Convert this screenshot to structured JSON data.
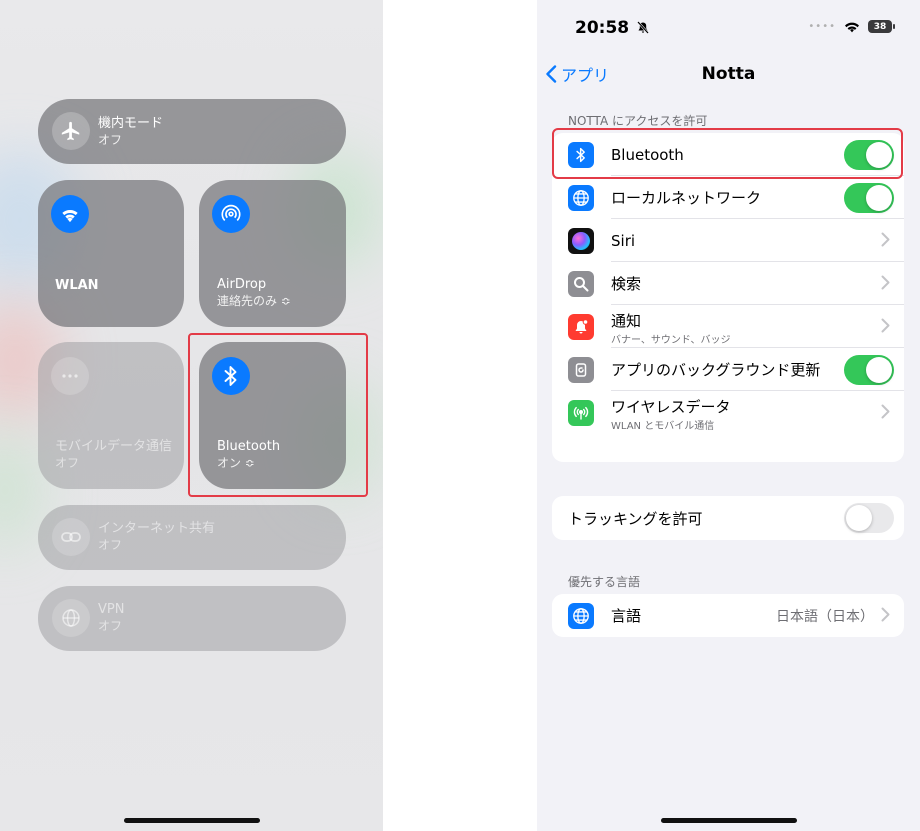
{
  "control_center": {
    "airplane": {
      "title": "機内モード",
      "status": "オフ",
      "icon": "airplane-icon"
    },
    "wlan": {
      "title": "WLAN",
      "icon": "wifi-icon"
    },
    "airdrop": {
      "title": "AirDrop",
      "status": "連絡先のみ ≎",
      "icon": "airdrop-icon"
    },
    "mobile_data": {
      "title": "モバイルデータ通信",
      "status": "オフ",
      "icon": "antenna-icon"
    },
    "bluetooth": {
      "title": "Bluetooth",
      "status": "オン ≎",
      "icon": "bluetooth-icon"
    },
    "hotspot": {
      "title": "インターネット共有",
      "status": "オフ",
      "icon": "link-icon"
    },
    "vpn": {
      "title": "VPN",
      "status": "オフ",
      "icon": "globe-icon"
    }
  },
  "settings": {
    "status_bar": {
      "time": "20:58",
      "battery": "38"
    },
    "nav": {
      "back_label": "アプリ",
      "title": "Notta"
    },
    "section_access": "NOTTA にアクセスを許可",
    "rows": [
      {
        "label": "Bluetooth",
        "icon": "bluetooth-icon",
        "icon_bg": "#0a7aff",
        "toggle": true
      },
      {
        "label": "ローカルネットワーク",
        "icon": "globe-network-icon",
        "icon_bg": "#0a7aff",
        "toggle": true
      },
      {
        "label": "Siri",
        "icon": "siri-icon",
        "icon_bg": "#111111"
      },
      {
        "label": "検索",
        "icon": "search-icon",
        "icon_bg": "#8e8e93"
      },
      {
        "label": "通知",
        "sub": "バナー、サウンド、バッジ",
        "icon": "bell-icon",
        "icon_bg": "#ff3b30"
      },
      {
        "label": "アプリのバックグラウンド更新",
        "icon": "refresh-icon",
        "icon_bg": "#8e8e93",
        "toggle": true
      },
      {
        "label": "ワイヤレスデータ",
        "sub": "WLAN とモバイル通信",
        "icon": "antenna-icon",
        "icon_bg": "#34c759"
      }
    ],
    "tracking": {
      "label": "トラッキングを許可",
      "toggle": false
    },
    "section_language": "優先する言語",
    "language": {
      "label": "言語",
      "value": "日本語（日本）",
      "icon": "globe-icon",
      "icon_bg": "#0a7aff"
    }
  },
  "colors": {
    "accent": "#0a7aff",
    "toggle_on": "#34c759",
    "highlight": "#e33b47"
  }
}
